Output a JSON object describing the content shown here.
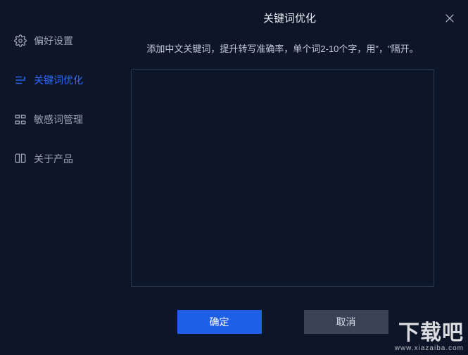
{
  "sidebar": {
    "items": [
      {
        "label": "偏好设置",
        "icon": "gear"
      },
      {
        "label": "关键词优化",
        "icon": "keyword"
      },
      {
        "label": "敏感词管理",
        "icon": "blocks"
      },
      {
        "label": "关于产品",
        "icon": "book"
      }
    ],
    "active_index": 1
  },
  "header": {
    "title": "关键词优化"
  },
  "main": {
    "description": "添加中文关键词，提升转写准确率，单个词2-10个字，用\"，\"隔开。",
    "textarea_value": "",
    "buttons": {
      "confirm": "确定",
      "cancel": "取消"
    }
  },
  "watermark": {
    "title": "下载吧",
    "sub": "www.xiazaiba.com"
  },
  "colors": {
    "background": "#0d1629",
    "accent": "#2b69ff",
    "primary_btn": "#1d5fe7",
    "secondary_btn": "#3a4356",
    "border": "#2a3552"
  }
}
